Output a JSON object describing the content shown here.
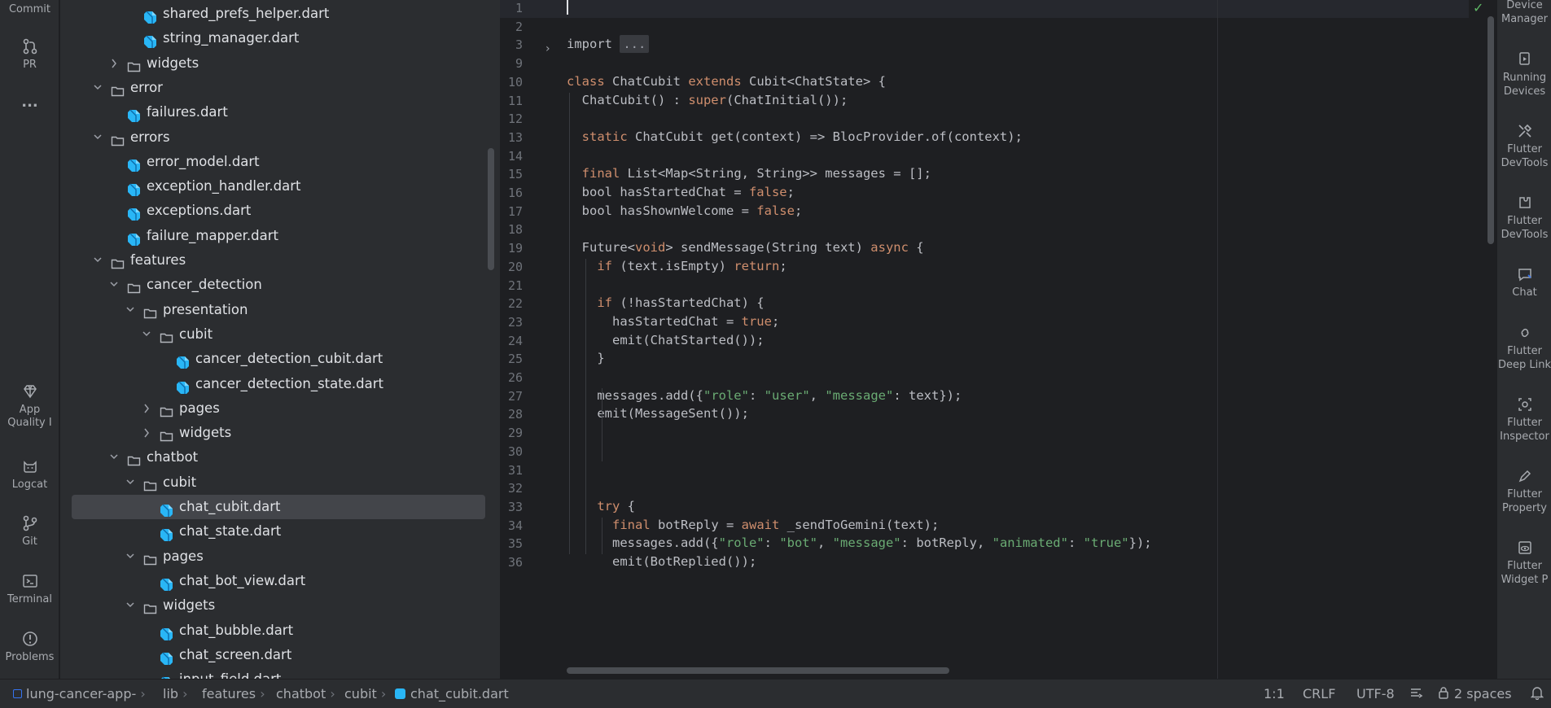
{
  "left_toolbar": {
    "commit": "Commit",
    "pr": "PR",
    "more": "...",
    "app_quality_1": "App",
    "app_quality_2": "Quality I",
    "logcat": "Logcat",
    "git": "Git",
    "terminal": "Terminal",
    "problems": "Problems"
  },
  "project_tree": [
    {
      "label": "shared_prefs_helper.dart",
      "type": "dart"
    },
    {
      "label": "string_manager.dart",
      "type": "dart"
    },
    {
      "label": "widgets",
      "type": "folder",
      "expanded": false
    },
    {
      "label": "error",
      "type": "folder",
      "expanded": true
    },
    {
      "label": "failures.dart",
      "type": "dart"
    },
    {
      "label": "errors",
      "type": "folder",
      "expanded": true
    },
    {
      "label": "error_model.dart",
      "type": "dart"
    },
    {
      "label": "exception_handler.dart",
      "type": "dart"
    },
    {
      "label": "exceptions.dart",
      "type": "dart"
    },
    {
      "label": "failure_mapper.dart",
      "type": "dart"
    },
    {
      "label": "features",
      "type": "folder",
      "expanded": true
    },
    {
      "label": "cancer_detection",
      "type": "folder",
      "expanded": true
    },
    {
      "label": "presentation",
      "type": "folder",
      "expanded": true
    },
    {
      "label": "cubit",
      "type": "folder",
      "expanded": true
    },
    {
      "label": "cancer_detection_cubit.dart",
      "type": "dart"
    },
    {
      "label": "cancer_detection_state.dart",
      "type": "dart"
    },
    {
      "label": "pages",
      "type": "folder",
      "expanded": false
    },
    {
      "label": "widgets",
      "type": "folder",
      "expanded": false
    },
    {
      "label": "chatbot",
      "type": "folder",
      "expanded": true
    },
    {
      "label": "cubit",
      "type": "folder",
      "expanded": true
    },
    {
      "label": "chat_cubit.dart",
      "type": "dart",
      "selected": true
    },
    {
      "label": "chat_state.dart",
      "type": "dart"
    },
    {
      "label": "pages",
      "type": "folder",
      "expanded": true
    },
    {
      "label": "chat_bot_view.dart",
      "type": "dart"
    },
    {
      "label": "widgets",
      "type": "folder",
      "expanded": true
    },
    {
      "label": "chat_bubble.dart",
      "type": "dart"
    },
    {
      "label": "chat_screen.dart",
      "type": "dart"
    },
    {
      "label": "input_field.dart",
      "type": "dart"
    }
  ],
  "editor": {
    "lines": [
      {
        "n": "1",
        "code": ""
      },
      {
        "n": "2",
        "code": ""
      },
      {
        "n": "3",
        "code": "import ..."
      },
      {
        "n": "9",
        "code": ""
      },
      {
        "n": "10",
        "code": "class ChatCubit extends Cubit<ChatState> {"
      },
      {
        "n": "11",
        "code": "  ChatCubit() : super(ChatInitial());"
      },
      {
        "n": "12",
        "code": ""
      },
      {
        "n": "13",
        "code": "  static ChatCubit get(context) => BlocProvider.of(context);"
      },
      {
        "n": "14",
        "code": ""
      },
      {
        "n": "15",
        "code": "  final List<Map<String, String>> messages = [];"
      },
      {
        "n": "16",
        "code": "  bool hasStartedChat = false;"
      },
      {
        "n": "17",
        "code": "  bool hasShownWelcome = false;"
      },
      {
        "n": "18",
        "code": ""
      },
      {
        "n": "19",
        "code": "  Future<void> sendMessage(String text) async {"
      },
      {
        "n": "20",
        "code": "    if (text.isEmpty) return;"
      },
      {
        "n": "21",
        "code": ""
      },
      {
        "n": "22",
        "code": "    if (!hasStartedChat) {"
      },
      {
        "n": "23",
        "code": "      hasStartedChat = true;"
      },
      {
        "n": "24",
        "code": "      emit(ChatStarted());"
      },
      {
        "n": "25",
        "code": "    }"
      },
      {
        "n": "26",
        "code": ""
      },
      {
        "n": "27",
        "code": "    messages.add({\"role\": \"user\", \"message\": text});"
      },
      {
        "n": "28",
        "code": "    emit(MessageSent());"
      },
      {
        "n": "29",
        "code": ""
      },
      {
        "n": "30",
        "code": ""
      },
      {
        "n": "31",
        "code": ""
      },
      {
        "n": "32",
        "code": ""
      },
      {
        "n": "33",
        "code": "    try {"
      },
      {
        "n": "34",
        "code": "      final botReply = await _sendToGemini(text);"
      },
      {
        "n": "35",
        "code": "      messages.add({\"role\": \"bot\", \"message\": botReply, \"animated\": \"true\"});"
      },
      {
        "n": "36",
        "code": "      emit(BotReplied());"
      }
    ]
  },
  "right_toolbar": [
    {
      "l1": "Device",
      "l2": "Manager",
      "icon": "device-manager-icon"
    },
    {
      "l1": "Running",
      "l2": "Devices",
      "icon": "running-devices-icon"
    },
    {
      "l1": "Flutter",
      "l2": "DevTools",
      "icon": "flutter-devtools-icon"
    },
    {
      "l1": "Flutter",
      "l2": "DevTools",
      "icon": "flutter-devtools-extensions-icon"
    },
    {
      "l1": "Chat",
      "l2": "",
      "icon": "chat-icon"
    },
    {
      "l1": "Flutter",
      "l2": "Deep Link",
      "icon": "deep-link-icon"
    },
    {
      "l1": "Flutter",
      "l2": "Inspector",
      "icon": "inspector-icon"
    },
    {
      "l1": "Flutter",
      "l2": "Property",
      "icon": "property-editor-icon"
    },
    {
      "l1": "Flutter",
      "l2": "Widget P",
      "icon": "widget-preview-icon"
    }
  ],
  "status_bar": {
    "breadcrumbs": [
      "lung-cancer-app-",
      "lib",
      "features",
      "chatbot",
      "cubit",
      "chat_cubit.dart"
    ],
    "position": "1:1",
    "line_sep": "CRLF",
    "encoding": "UTF-8",
    "indent": "2 spaces"
  }
}
